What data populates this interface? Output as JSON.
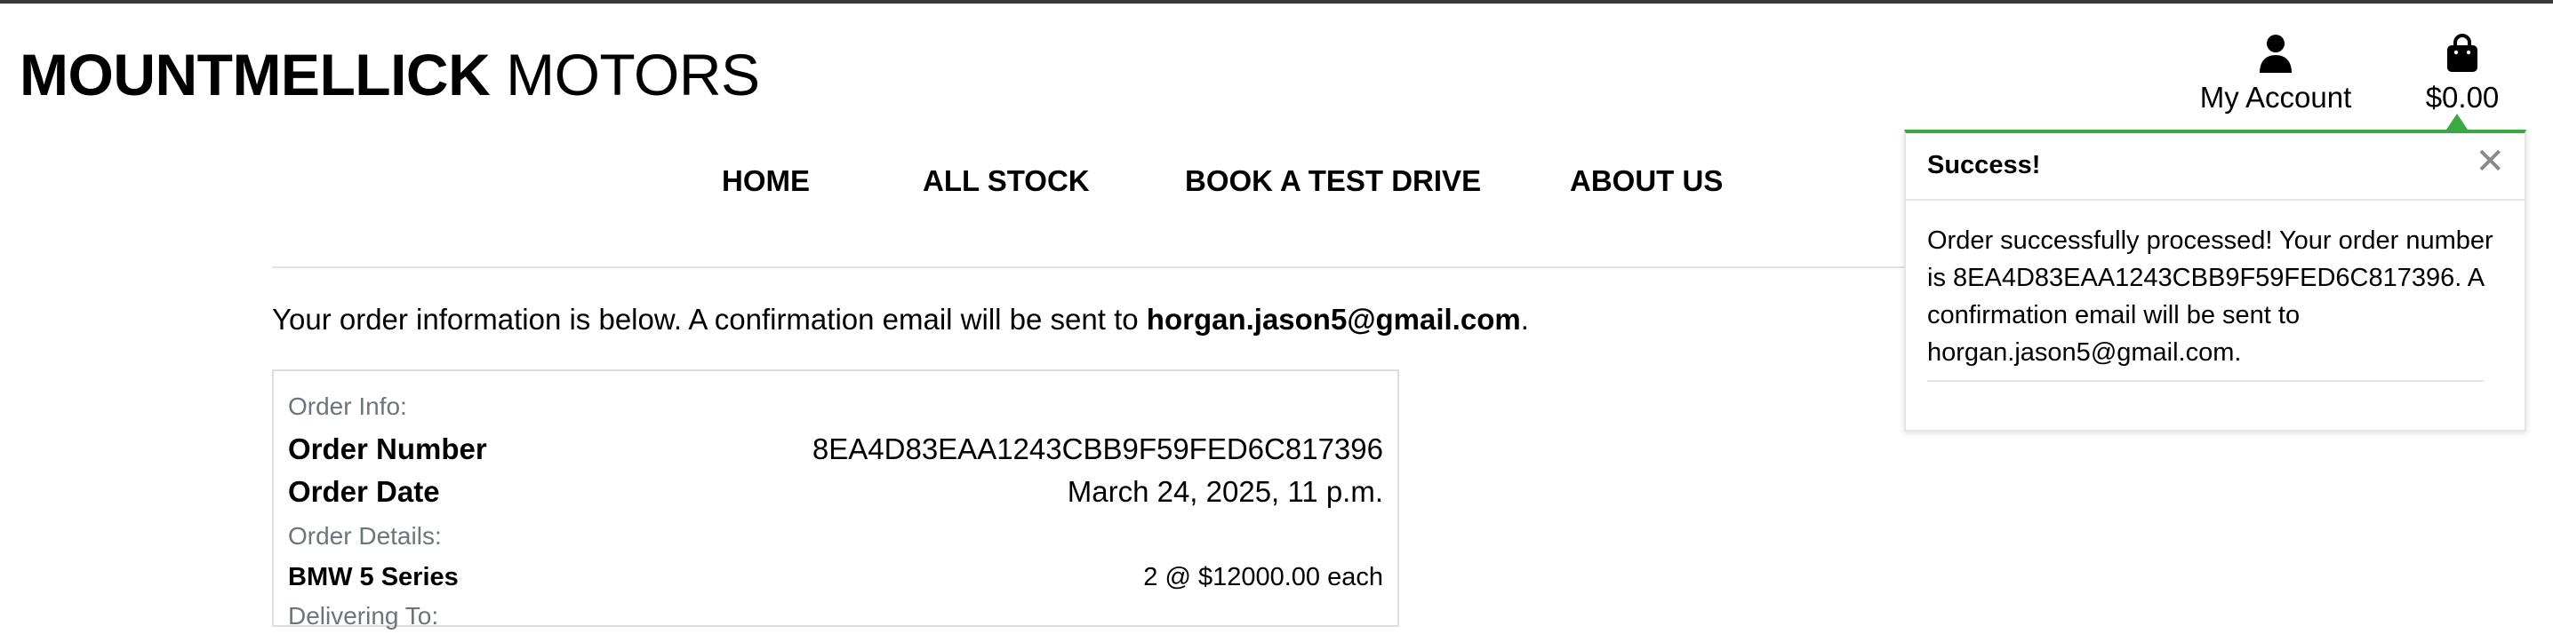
{
  "brand": {
    "bold": "MOUNTMELLICK",
    "light": "MOTORS"
  },
  "header": {
    "account_label": "My Account",
    "account_icon": "user-icon",
    "bag_total": "$0.00",
    "bag_icon": "shopping-bag-icon"
  },
  "nav": [
    "HOME",
    "ALL STOCK",
    "BOOK A TEST DRIVE",
    "ABOUT US"
  ],
  "intro": {
    "text_before": "Your order information is below. A confirmation email will be sent to ",
    "email": "horgan.jason5@gmail.com",
    "text_after": "."
  },
  "order": {
    "info_heading": "Order Info:",
    "number_label": "Order Number",
    "number_value": "8EA4D83EAA1243CBB9F59FED6C817396",
    "date_label": "Order Date",
    "date_value": "March 24, 2025, 11 p.m.",
    "details_heading": "Order Details:",
    "items": [
      {
        "name": "BMW 5 Series",
        "qty_price": "2 @ $12000.00 each"
      }
    ],
    "delivery_heading": "Delivering To:"
  },
  "toast": {
    "title": "Success!",
    "message": "Order successfully processed! Your order number is 8EA4D83EAA1243CBB9F59FED6C817396. A confirmation email will be sent to horgan.jason5@gmail.com.",
    "close_icon": "close-icon",
    "accent": "#3aa845"
  }
}
